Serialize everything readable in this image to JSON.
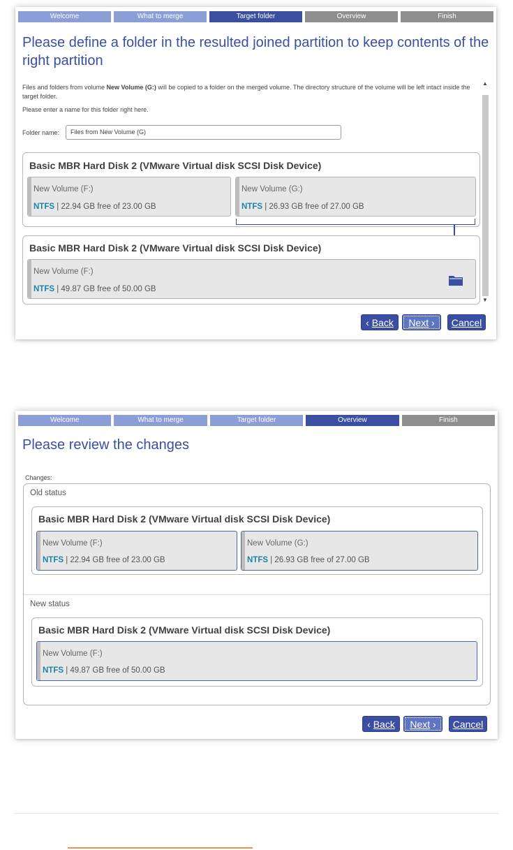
{
  "screen1": {
    "steps": [
      {
        "label": "Welcome",
        "state": "done"
      },
      {
        "label": "What to merge",
        "state": "done"
      },
      {
        "label": "Target folder",
        "state": "active"
      },
      {
        "label": "Overview",
        "state": "todo"
      },
      {
        "label": "Finish",
        "state": "todo"
      }
    ],
    "title": "Please define a folder in the resulted joined partition to keep contents of the right partition",
    "desc_before": "Files and folders from volume ",
    "desc_bold": "New Volume (G:)",
    "desc_after": " will be copied to a folder on the merged volume. The directory structure of the volume will be left intact inside the target folder.",
    "desc2": "Please enter a name for this folder right here.",
    "folder_label": "Folder name:",
    "folder_value": "Files from New Volume (G)",
    "disk1": {
      "title": "Basic MBR Hard Disk 2 (VMware Virtual disk SCSI Disk Device)",
      "partitions": [
        {
          "name": "New Volume (F:)",
          "fs": "NTFS",
          "info": " | 22.94 GB free of 23.00 GB"
        },
        {
          "name": "New Volume (G:)",
          "fs": "NTFS",
          "info": " | 26.93 GB free of 27.00 GB"
        }
      ]
    },
    "disk2": {
      "title": "Basic MBR Hard Disk 2 (VMware Virtual disk SCSI Disk Device)",
      "partitions": [
        {
          "name": "New Volume (F:)",
          "fs": "NTFS",
          "info": " | 49.87 GB free of 50.00 GB"
        }
      ]
    },
    "buttons": {
      "back": "Back",
      "next": "Next",
      "cancel": "Cancel"
    },
    "icons": [
      "folder-icon",
      "arrow-down-icon",
      "scroll-up-icon",
      "scroll-down-icon"
    ]
  },
  "screen2": {
    "steps": [
      {
        "label": "Welcome",
        "state": "done"
      },
      {
        "label": "What to merge",
        "state": "done"
      },
      {
        "label": "Target folder",
        "state": "done"
      },
      {
        "label": "Overview",
        "state": "active"
      },
      {
        "label": "Finish",
        "state": "todo"
      }
    ],
    "title": "Please review the changes",
    "changes_label": "Changes:",
    "old_status_label": "Old status",
    "new_status_label": "New status",
    "old_disk": {
      "title": "Basic MBR Hard Disk 2 (VMware Virtual disk SCSI Disk Device)",
      "partitions": [
        {
          "name": "New Volume (F:)",
          "fs": "NTFS",
          "info": " | 22.94 GB free of 23.00 GB"
        },
        {
          "name": "New Volume (G:)",
          "fs": "NTFS",
          "info": " | 26.93 GB free of 27.00 GB"
        }
      ]
    },
    "new_disk": {
      "title": "Basic MBR Hard Disk 2 (VMware Virtual disk SCSI Disk Device)",
      "partitions": [
        {
          "name": "New Volume (F:)",
          "fs": "NTFS",
          "info": " | 49.87 GB free of 50.00 GB"
        }
      ]
    },
    "buttons": {
      "back": "Back",
      "next": "Next",
      "cancel": "Cancel"
    }
  },
  "colors": {
    "accent": "#3a4fa3",
    "step_done": "#8c9ed6",
    "step_todo": "#8e8e8e",
    "fs_label": "#1a83a6"
  }
}
